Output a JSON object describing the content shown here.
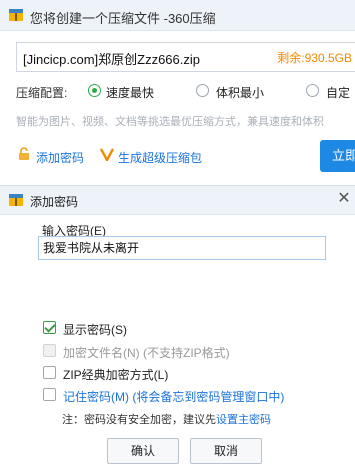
{
  "window": {
    "title": "您将创建一个压缩文件 -360压缩"
  },
  "file": {
    "name": "[Jincicp.com]郑原创Zzz666.zip",
    "free_space": "剩余:930.5GB"
  },
  "config": {
    "label": "压缩配置:",
    "options": [
      {
        "label": "速度最快",
        "selected": true
      },
      {
        "label": "体积最小",
        "selected": false
      },
      {
        "label": "自定",
        "selected": false
      }
    ],
    "hint": "智能为图片、视频、文档等挑选最优压缩方式，兼具速度和体积"
  },
  "actions": {
    "add_password": "添加密码",
    "super_compress": "生成超级压缩包",
    "start": "立即"
  },
  "dialog": {
    "title": "添加密码",
    "input_label": "输入密码(E)",
    "password_value": "我爱书院从未离开",
    "options": [
      {
        "label": "显示密码(S)",
        "checked": true,
        "disabled": false
      },
      {
        "label": "加密文件名(N) (不支持ZIP格式)",
        "checked": false,
        "disabled": true
      },
      {
        "label": "ZIP经典加密方式(L)",
        "checked": false,
        "disabled": false
      },
      {
        "label": "记住密码(M) (将会备忘到密码管理窗口中)",
        "checked": false,
        "disabled": false
      }
    ],
    "note_prefix": "注：密码没有安全加密，建议先",
    "note_link": "设置主密码",
    "ok": "确认",
    "cancel": "取消"
  },
  "colors": {
    "accent_blue": "#1e88e5",
    "free_space_orange": "#f08a00",
    "check_green": "#3a9a48",
    "link_blue": "#1a73d9"
  }
}
